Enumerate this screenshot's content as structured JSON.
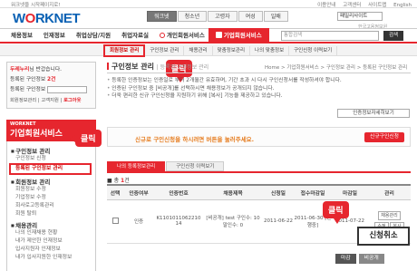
{
  "topbar": {
    "site_link": "워크넷을 시작페이지로!",
    "links": [
      "이용안내",
      "고객센터",
      "사이트맵",
      "English"
    ]
  },
  "logo": {
    "text_prefix": "W",
    "text_accent": "O",
    "text_suffix": "RKNET"
  },
  "nav_tabs": [
    "워크넷",
    "청소년",
    "고령자",
    "여성",
    "일배"
  ],
  "site_select": "패밀리사이트",
  "slogan": "한국고용정보원",
  "main_menu": {
    "items": [
      "채용정보",
      "인재정보",
      "취업상담/지원",
      "취업자료실"
    ],
    "personal": "개인회원서비스",
    "corporate": "기업회원서비스"
  },
  "search": {
    "placeholder": "통합검색",
    "button": "검색"
  },
  "submenu": [
    "회원정보 관리",
    "구인정보 관리",
    "채용관리",
    "맞춤정보관리",
    "나의 맞춤정보",
    "구인신청 이력보기",
    "구인정보 관리"
  ],
  "callout_label": "클릭",
  "login": {
    "greeting": "두레누리",
    "greeting_suffix": "님 반갑습니다.",
    "row2_label": "등록된 구인정보",
    "row2_count": "2건",
    "row3_label": "등록된 구인정보",
    "select_value": "",
    "links": [
      "회원정보관리",
      "고객지원",
      "로그아웃"
    ]
  },
  "lnb": {
    "eng": "WORKNET",
    "title": "기업회원서비스",
    "groups": [
      {
        "title": "구인정보 관리",
        "items": [
          "구인정보 신청",
          "등록된 구인정보 관리"
        ]
      },
      {
        "title": "회원정보 관리",
        "items": [
          "회원정보 수정",
          "기업정보 수정",
          "회사로고등록관리",
          "회원 탈퇴"
        ]
      },
      {
        "title": "채용관리",
        "items": [
          "나의 인재채용 현황",
          "내가 제안한 인재정보",
          "입사지원자 인재정보",
          "내가 입사지원한 인재정보"
        ]
      }
    ]
  },
  "page": {
    "title": "구인정보 관리",
    "title_sub": "| 등록된 구인정보 관리",
    "breadcrumb": "Home > 기업회원서비스 > 구인정보 관리 > 등록된 구인정보 관리"
  },
  "descriptions": [
    "등록한 인증정보는 인증일로 부터 2개월간 유효하며, 기간 초과 시 다시 구인신청서를 작성하셔야 합니다.",
    "인증된 구인정보 중 [비공개]를 선택하시면 채용정보가 공개되지 않습니다.",
    "더욱 편리한 신규 구인신청을 지원하기 위해 [복사] 기능을 제공하고 있습니다."
  ],
  "print_button": "인증정보자세히보기",
  "notice": {
    "text": "신규로 구인신청을 하시려면 버튼을 눌러주세요.",
    "button": "신규구인신청"
  },
  "content_tabs": [
    "나의 등록정보관리",
    "구인신청 이력보기"
  ],
  "total": {
    "label": "총",
    "count": "1",
    "suffix": "건"
  },
  "table": {
    "headers": [
      "선택",
      "인증여부",
      "인증번호",
      "채용제목",
      "신청일",
      "접수마감일",
      "마감일",
      "관리"
    ],
    "rows": [
      {
        "status": "인증",
        "cert_no": "K1101011062210 14",
        "title": "[비공개] test 구인수: 10 말인수: 0",
        "apply_date": "2011-06-22",
        "deadline": "2011-06-30 [진행중]",
        "close_date": "2011-07-22",
        "actions": [
          "채용관리",
          "수정",
          "복사"
        ]
      }
    ]
  },
  "cancel_popup": "신청취소",
  "bottom_buttons": [
    "마감",
    "비공개"
  ]
}
